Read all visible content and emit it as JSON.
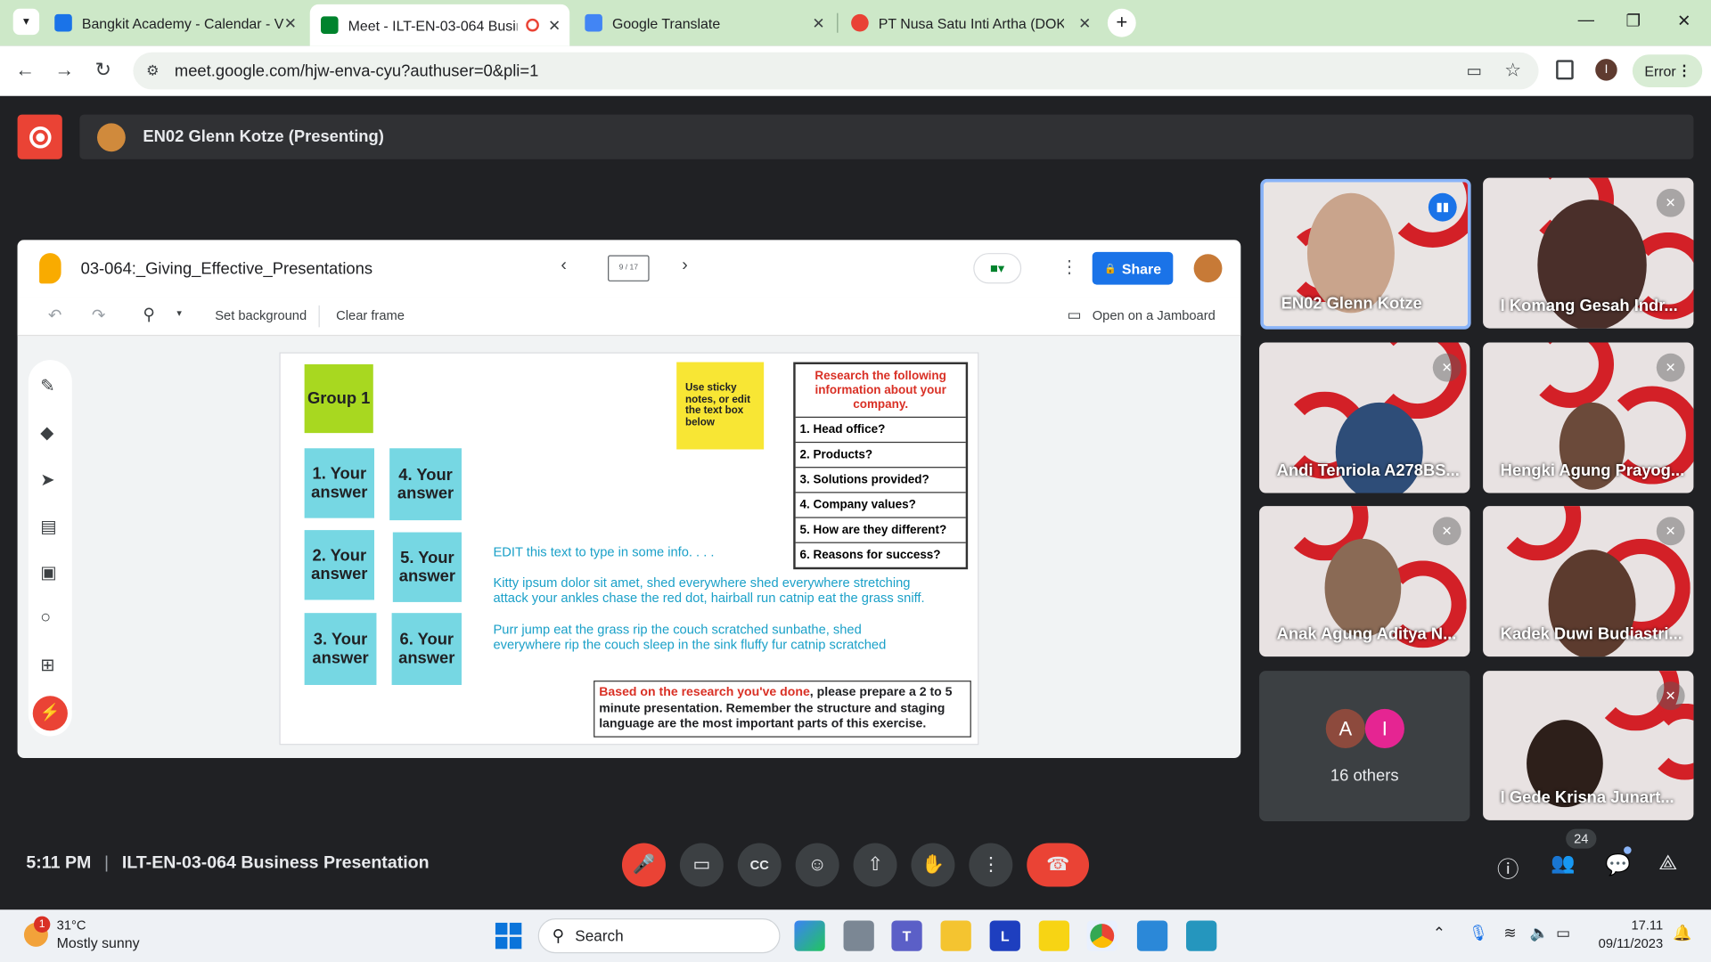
{
  "browser": {
    "tabs": [
      {
        "title": "Bangkit Academy - Calendar - V",
        "color": "#1a73e8"
      },
      {
        "title": "Meet - ILT-EN-03-064 Busin",
        "color": "#00832d"
      },
      {
        "title": "Google Translate",
        "color": "#4285f4"
      },
      {
        "title": "PT Nusa Satu Inti Artha (DOKU)",
        "color": "#e94235"
      }
    ],
    "url": "meet.google.com/hjw-enva-cyu?authuser=0&pli=1",
    "profile_initial": "I",
    "error_label": "Error"
  },
  "meet": {
    "presenting": "EN02 Glenn Kotze (Presenting)",
    "time": "5:11 PM",
    "meeting_title": "ILT-EN-03-064 Business Presentation",
    "participants_count": "24",
    "others_label": "16 others",
    "others_avatars": [
      {
        "letter": "A",
        "color": "#8d4a3d"
      },
      {
        "letter": "I",
        "color": "#e52592"
      }
    ],
    "tiles": [
      {
        "name": "EN02 Glenn Kotze",
        "speaking": true
      },
      {
        "name": "I Komang Gesah Indr..."
      },
      {
        "name": "Andi Tenriola A278BS..."
      },
      {
        "name": "Hengki Agung Prayog..."
      },
      {
        "name": "Anak Agung Aditya N..."
      },
      {
        "name": "Kadek Duwi Budiastri..."
      },
      {
        "name": "I Gede Krisna Junart..."
      }
    ]
  },
  "jamboard": {
    "title": "03-064:_Giving_Effective_Presentations",
    "frame": "9 / 17",
    "share_label": "Share",
    "set_background": "Set background",
    "clear_frame": "Clear frame",
    "open_label": "Open on a Jamboard",
    "group_label": "Group 1",
    "sticky_hint": "Use sticky notes, or edit the text box below",
    "answers": [
      "1. Your answer",
      "4. Your answer",
      "2. Your answer",
      "5. Your answer",
      "3. Your answer",
      "6. Your answer"
    ],
    "research_header": "Research the following information about your company.",
    "research_items": [
      "1. Head office?",
      "2. Products?",
      "3. Solutions provided?",
      "4. Company values?",
      "5. How are they different?",
      "6. Reasons for success?"
    ],
    "edit_text": "EDIT this text to type in some info. . . .",
    "para1": "Kitty ipsum dolor sit amet, shed everywhere shed everywhere stretching attack your ankles chase the red dot, hairball run catnip eat the grass sniff.",
    "para2": "Purr jump eat the grass rip the couch scratched sunbathe, shed everywhere rip the couch sleep in the sink fluffy fur catnip scratched",
    "bottom_red": "Based on the research you've done",
    "bottom_rest": ", please prepare a 2 to 5 minute presentation. Remember the structure and staging language are the most important parts of this exercise."
  },
  "taskbar": {
    "weather_temp": "31°C",
    "weather_desc": "Mostly sunny",
    "weather_badge": "1",
    "search_label": "Search",
    "clock_time": "17.11",
    "clock_date": "09/11/2023"
  },
  "colors": {
    "accent": "#1a73e8",
    "danger": "#ea4335",
    "meet_bg": "#202124"
  }
}
